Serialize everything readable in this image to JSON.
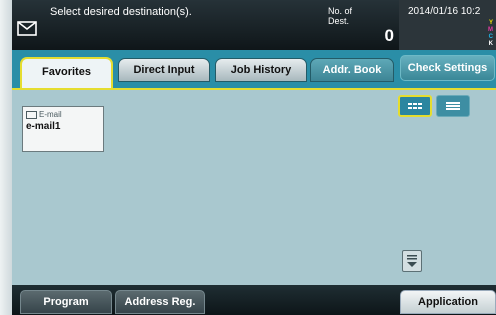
{
  "header": {
    "prompt": "Select desired destination(s).",
    "num_dest_label": "No. of Dest.",
    "num_dest_value": "0",
    "datetime": "2014/01/16 10:2",
    "toner": [
      "Y",
      "M",
      "C",
      "K"
    ]
  },
  "tabs": [
    "Favorites",
    "Direct Input",
    "Job History",
    "Addr. Book"
  ],
  "check_settings": "Check Settings",
  "destination": {
    "type": "E-mail",
    "name": "e-mail1"
  },
  "footer": {
    "program": "Program",
    "address_reg": "Address Reg.",
    "application": "Application"
  },
  "colors": {
    "accent": "#e5dd2f",
    "tab_bar": "#2a8ea7",
    "content_bg": "#a9c8cf"
  }
}
